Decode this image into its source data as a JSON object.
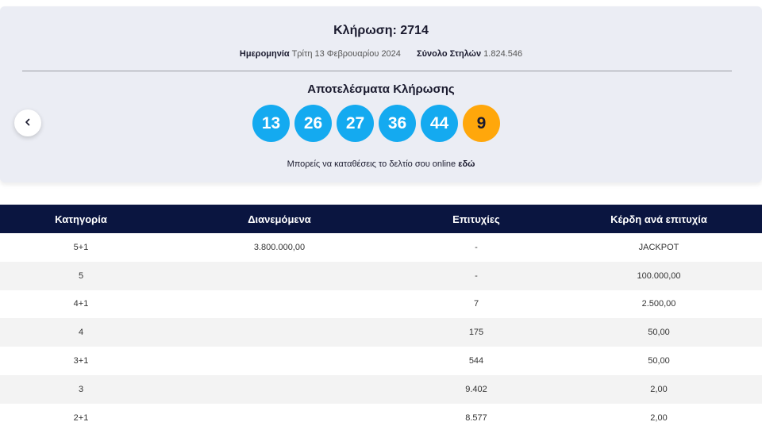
{
  "draw": {
    "title": "Κλήρωση: 2714",
    "date_label": "Ημερομηνία",
    "date_value": "Τρίτη 13 Φεβρουαρίου 2024",
    "columns_label": "Σύνολο Στηλών",
    "columns_value": "1.824.546"
  },
  "results": {
    "title": "Αποτελέσματα Κλήρωσης",
    "numbers": [
      "13",
      "26",
      "27",
      "36",
      "44"
    ],
    "bonus": "9",
    "colors": {
      "main": "#14aaf0",
      "bonus": "#ffa70b"
    }
  },
  "online": {
    "text": "Μπορείς να καταθέσεις το δελτίο σου online",
    "link": "εδώ"
  },
  "nav": {
    "prev_icon": "chevron-left-icon"
  },
  "table": {
    "headers": [
      "Κατηγορία",
      "Διανεμόμενα",
      "Επιτυχίες",
      "Κέρδη ανά επιτυχία"
    ],
    "rows": [
      [
        "5+1",
        "3.800.000,00",
        "-",
        "JACKPOT"
      ],
      [
        "5",
        "",
        "-",
        "100.000,00"
      ],
      [
        "4+1",
        "",
        "7",
        "2.500,00"
      ],
      [
        "4",
        "",
        "175",
        "50,00"
      ],
      [
        "3+1",
        "",
        "544",
        "50,00"
      ],
      [
        "3",
        "",
        "9.402",
        "2,00"
      ],
      [
        "2+1",
        "",
        "8.577",
        "2,00"
      ]
    ],
    "header_color": "#0a1540"
  }
}
